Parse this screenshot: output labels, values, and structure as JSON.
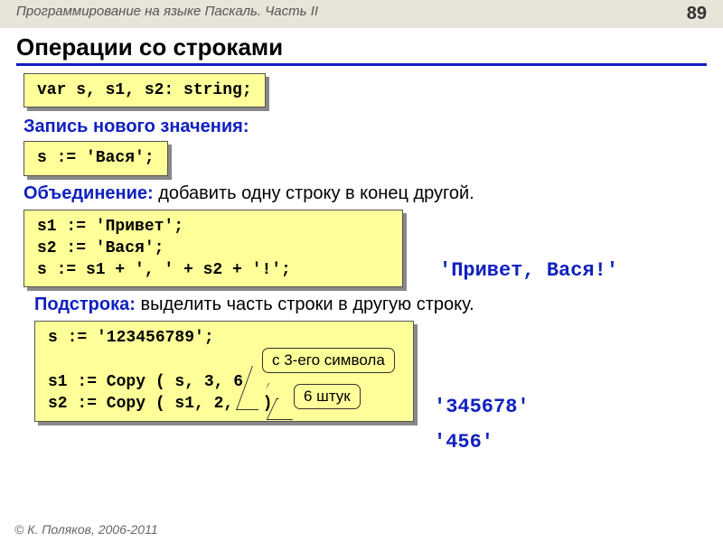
{
  "header": {
    "course": "Программирование на языке Паскаль. Часть II",
    "page": "89"
  },
  "title": "Операции со строками",
  "declare": "var s, s1, s2: string;",
  "section_assign": {
    "heading": "Запись нового значения:",
    "code": "s := 'Вася';"
  },
  "section_concat": {
    "label": "Объединение:",
    "desc": " добавить одну строку в конец другой.",
    "code": "s1 := 'Привет';\ns2 := 'Вася';\ns := s1 + ', ' + s2 + '!';",
    "result": "'Привет, Вася!'"
  },
  "section_sub": {
    "label": "Подстрока:",
    "desc": " выделить часть строки в другую строку.",
    "code": "s := '123456789';\n\ns1 := Copy ( s, 3, 6 );\ns2 := Copy ( s1, 2, 3 );",
    "callout1": "с 3-его символа",
    "callout2": "6 штук",
    "result1": "'345678'",
    "result2": "'456'"
  },
  "footer": "© К. Поляков, 2006-2011"
}
